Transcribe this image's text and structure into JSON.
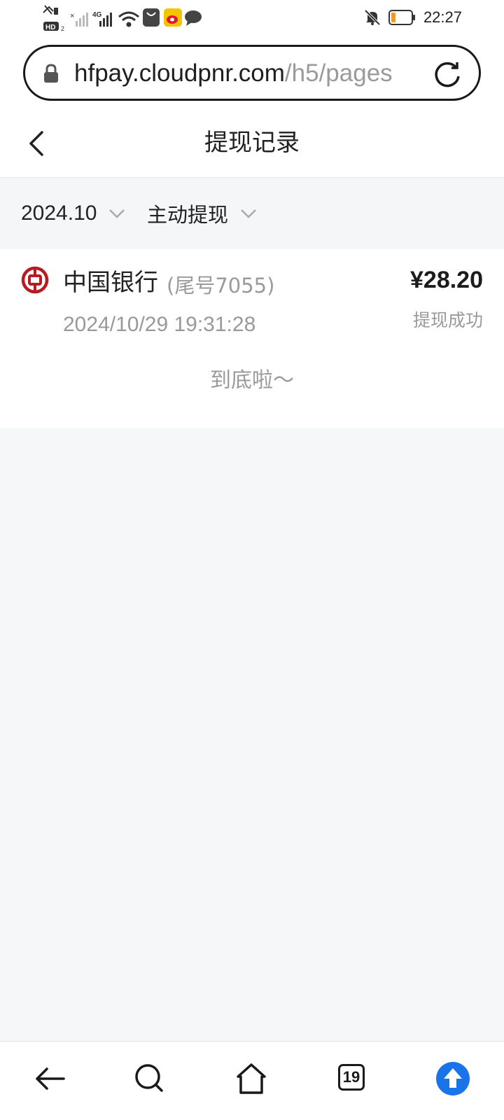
{
  "status_bar": {
    "time": "22:27",
    "left_icons": [
      "missed-call-icon",
      "hd-icon",
      "signal-icon",
      "4g-signal-icon",
      "wifi-icon",
      "app-notification-icon",
      "weibo-icon",
      "message-icon"
    ],
    "right_icons": [
      "silent-bell-icon",
      "battery-icon"
    ]
  },
  "browser": {
    "url_host": "hfpay.cloudpnr.com",
    "url_path": "/h5/pages"
  },
  "header": {
    "title": "提现记录"
  },
  "filters": {
    "date": "2024.10",
    "type": "主动提现"
  },
  "records": [
    {
      "bank": "中国银行",
      "tail": "(尾号7055)",
      "time": "2024/10/29 19:31:28",
      "amount": "¥28.20",
      "status": "提现成功"
    }
  ],
  "list_end": "到底啦～",
  "bottom_nav": {
    "tab_count": "19"
  },
  "colors": {
    "bank_red": "#b81c22",
    "accent_blue": "#1a73e8",
    "muted": "#9a9a9a"
  }
}
